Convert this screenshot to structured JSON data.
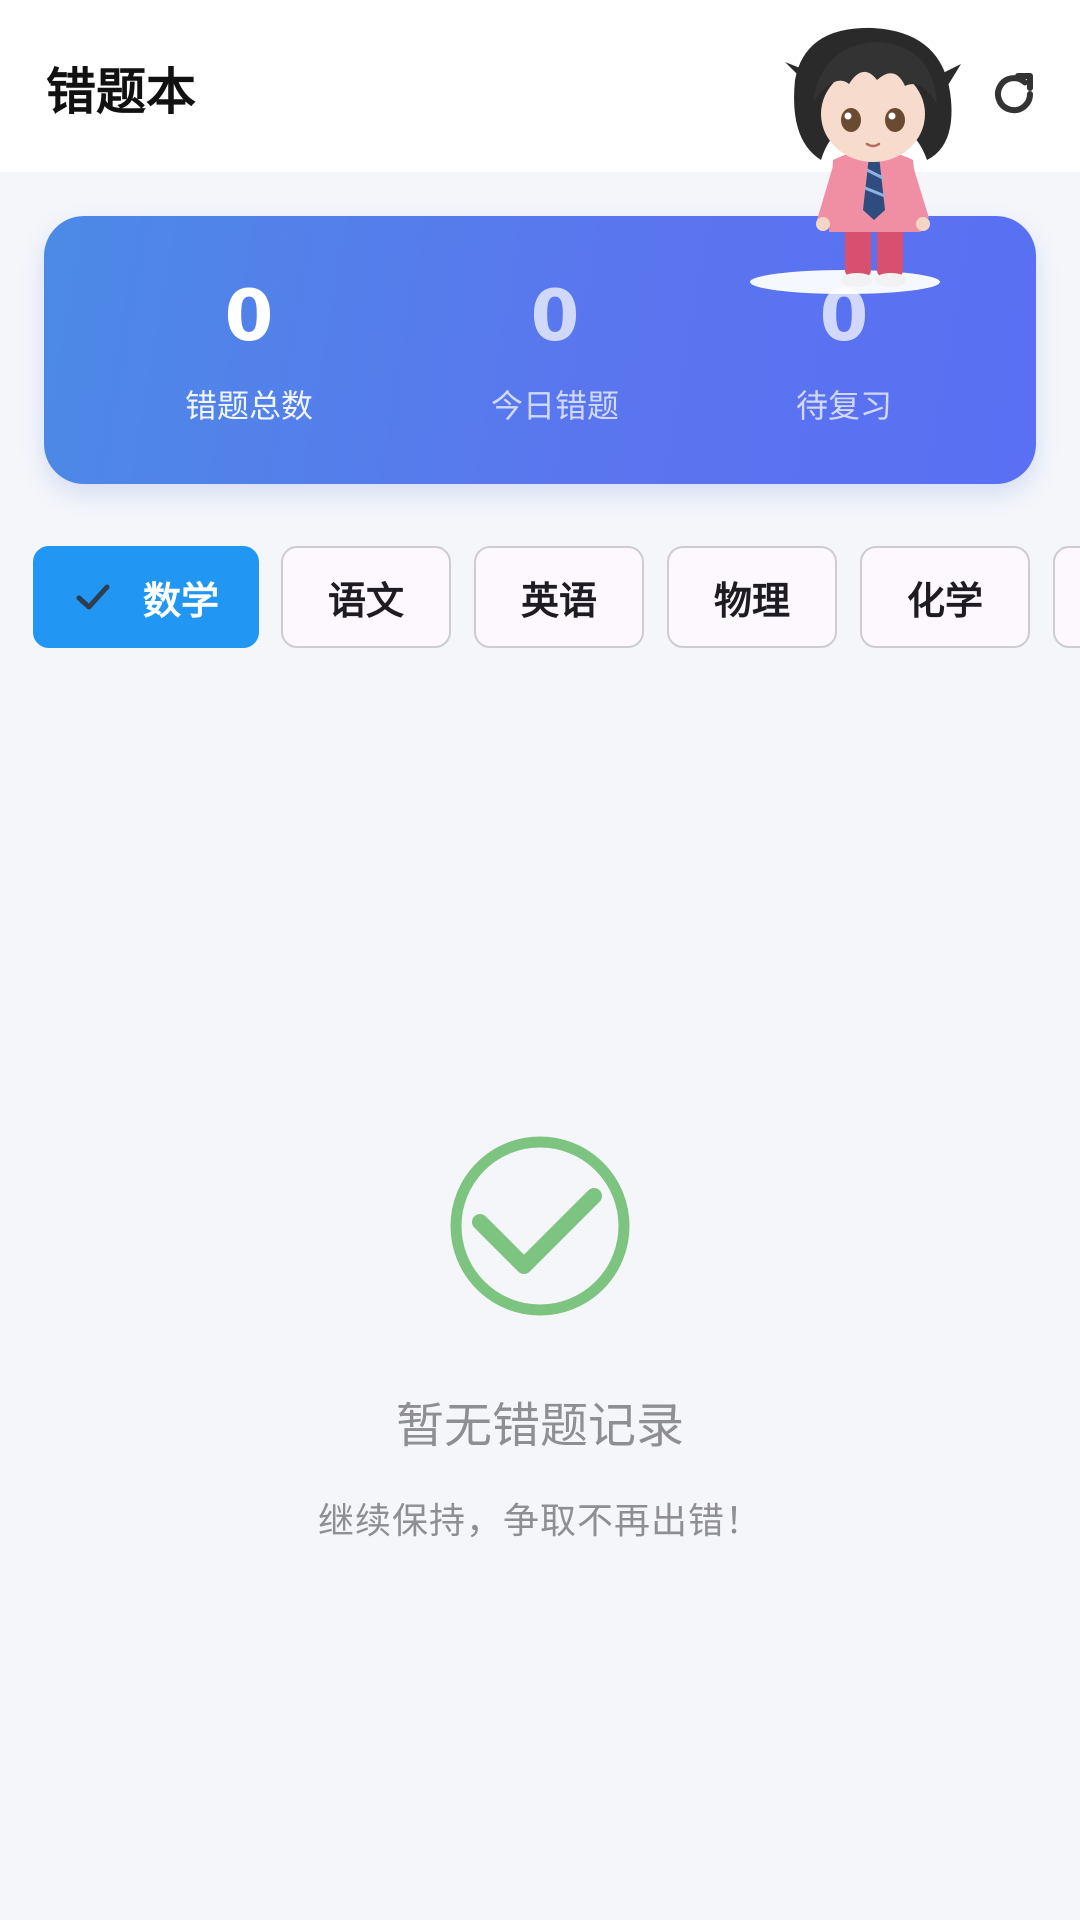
{
  "header": {
    "title": "错题本",
    "refresh_icon": "refresh-icon"
  },
  "stats": [
    {
      "value": "0",
      "label": "错题总数"
    },
    {
      "value": "0",
      "label": "今日错题"
    },
    {
      "value": "0",
      "label": "待复习"
    }
  ],
  "subjects": {
    "items": [
      {
        "label": "数学",
        "selected": true
      },
      {
        "label": "语文",
        "selected": false
      },
      {
        "label": "英语",
        "selected": false
      },
      {
        "label": "物理",
        "selected": false
      },
      {
        "label": "化学",
        "selected": false
      }
    ]
  },
  "empty_state": {
    "icon": "check-circle-icon",
    "title": "暂无错题记录",
    "subtitle": "继续保持，争取不再出错！"
  },
  "colors": {
    "accent": "#2196f3",
    "card_gradient_start": "#4c8ae6",
    "card_gradient_end": "#5a6ff4",
    "success": "#7cc47f",
    "background": "#f4f6fa"
  }
}
